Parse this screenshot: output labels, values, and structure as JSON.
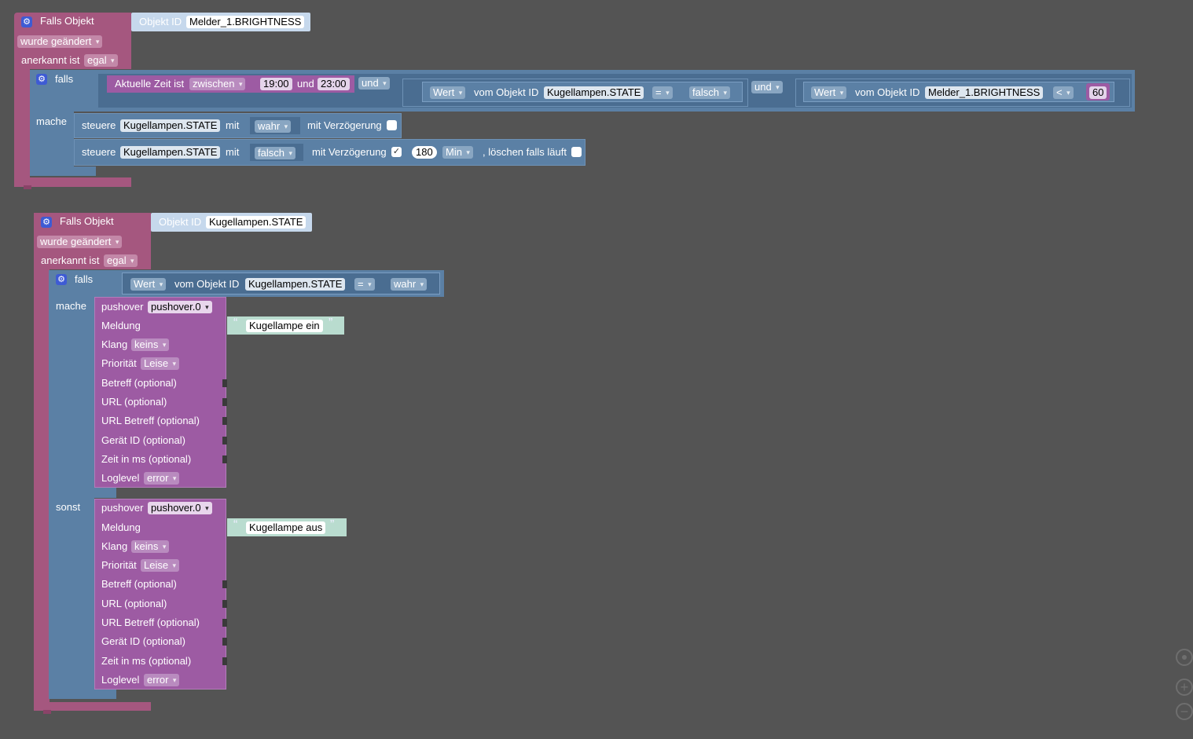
{
  "block1": {
    "header": "Falls Objekt",
    "objekt_id_label": "Objekt ID",
    "objekt_id_value": "Melder_1.BRIGHTNESS",
    "changed": "wurde geändert",
    "ack_label": "anerkannt ist",
    "ack_value": "egal",
    "if_label": "falls",
    "do_label": "mache",
    "cond": {
      "time_label": "Aktuelle Zeit ist",
      "time_op": "zwischen",
      "t1": "19:00",
      "and_word": "und",
      "t2": "23:00",
      "logic1": "und",
      "wert1": "Wert",
      "vom1": "vom Objekt ID",
      "obj1": "Kugellampen.STATE",
      "op1": "=",
      "val1": "falsch",
      "logic2": "und",
      "wert2": "Wert",
      "vom2": "vom Objekt ID",
      "obj2": "Melder_1.BRIGHTNESS",
      "op2": "<",
      "val2": "60"
    },
    "set1": {
      "label": "steuere",
      "obj": "Kugellampen.STATE",
      "mit": "mit",
      "val": "wahr",
      "delay": "mit Verzögerung"
    },
    "set2": {
      "label": "steuere",
      "obj": "Kugellampen.STATE",
      "mit": "mit",
      "val": "falsch",
      "delay": "mit Verzögerung",
      "checkmark": "✓",
      "amount": "180",
      "unit": "Min",
      "clear": ", löschen falls läuft"
    }
  },
  "block2": {
    "header": "Falls Objekt",
    "objekt_id_label": "Objekt ID",
    "objekt_id_value": "Kugellampen.STATE",
    "changed": "wurde geändert",
    "ack_label": "anerkannt ist",
    "ack_value": "egal",
    "if_label": "falls",
    "do_label": "mache",
    "else_label": "sonst",
    "cond": {
      "wert": "Wert",
      "vom": "vom Objekt ID",
      "obj": "Kugellampen.STATE",
      "op": "=",
      "val": "wahr"
    },
    "push1": {
      "label": "pushover",
      "instance": "pushover.0",
      "meldung": "Meldung",
      "message": "Kugellampe ein",
      "klang": "Klang",
      "klang_val": "keins",
      "prio": "Priorität",
      "prio_val": "Leise",
      "betreff": "Betreff (optional)",
      "url": "URL (optional)",
      "url_betreff": "URL Betreff (optional)",
      "geraet": "Gerät ID (optional)",
      "zeit": "Zeit in ms (optional)",
      "loglevel": "Loglevel",
      "loglevel_val": "error"
    },
    "push2": {
      "label": "pushover",
      "instance": "pushover.0",
      "meldung": "Meldung",
      "message": "Kugellampe aus",
      "klang": "Klang",
      "klang_val": "keins",
      "prio": "Priorität",
      "prio_val": "Leise",
      "betreff": "Betreff (optional)",
      "url": "URL (optional)",
      "url_betreff": "URL Betreff (optional)",
      "geraet": "Gerät ID (optional)",
      "zeit": "Zeit in ms (optional)",
      "loglevel": "Loglevel",
      "loglevel_val": "error"
    }
  },
  "quote_open": "“",
  "quote_close": "”",
  "gear_glyph": "⚙",
  "zoom": {
    "center_icon": "crosshair-icon",
    "plus": "+",
    "minus": "−"
  }
}
